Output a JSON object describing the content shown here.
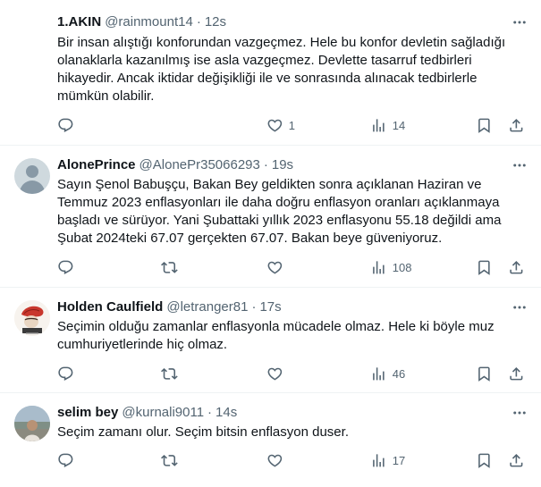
{
  "tweets": [
    {
      "name": "1.AKIN",
      "handle": "@rainmount14",
      "dot": "·",
      "time": "12s",
      "text": "Bir insan alıştığı konforundan vazgeçmez. Hele bu konfor devletin sağladığı olanaklarla kazanılmış ise asla vazgeçmez. Devlette tasarruf tedbirleri hikayedir. Ancak iktidar değişikliği ile ve sonrasında alınacak tedbirlerle mümkün olabilir.",
      "replies": "",
      "retweets": "",
      "likes": "1",
      "views": "14",
      "has_avatar": false
    },
    {
      "name": "AlonePrince",
      "handle": "@AlonePr35066293",
      "dot": "·",
      "time": "19s",
      "text": "Sayın Şenol Babuşçu, Bakan Bey geldikten sonra açıklanan Haziran ve Temmuz 2023 enflasyonları ile daha doğru enflasyon oranları açıklanmaya başladı ve sürüyor. Yani Şubattaki yıllık 2023 enflasyonu 55.18 değildi ama Şubat 2024teki 67.07 gerçekten 67.07. Bakan beye güveniyoruz.",
      "replies": "",
      "retweets": "",
      "likes": "",
      "views": "108",
      "has_avatar": true
    },
    {
      "name": "Holden Caulfield",
      "handle": "@letranger81",
      "dot": "·",
      "time": "17s",
      "text": "Seçimin olduğu zamanlar enflasyonla mücadele olmaz. Hele ki böyle muz cumhuriyetlerinde hiç olmaz.",
      "replies": "",
      "retweets": "",
      "likes": "",
      "views": "46",
      "has_avatar": true
    },
    {
      "name": "selim bey",
      "handle": "@kurnali9011",
      "dot": "·",
      "time": "14s",
      "text": "Seçim zamanı olur. Seçim bitsin enflasyon duser.",
      "replies": "",
      "retweets": "",
      "likes": "",
      "views": "17",
      "has_avatar": true
    }
  ],
  "icons": {
    "more": "more-icon",
    "reply": "reply-icon",
    "retweet": "retweet-icon",
    "like": "like-icon",
    "views": "views-icon",
    "bookmark": "bookmark-icon",
    "share": "share-icon"
  },
  "colors": {
    "text_primary": "#0f1419",
    "text_secondary": "#536471",
    "divider": "#eff3f4"
  }
}
